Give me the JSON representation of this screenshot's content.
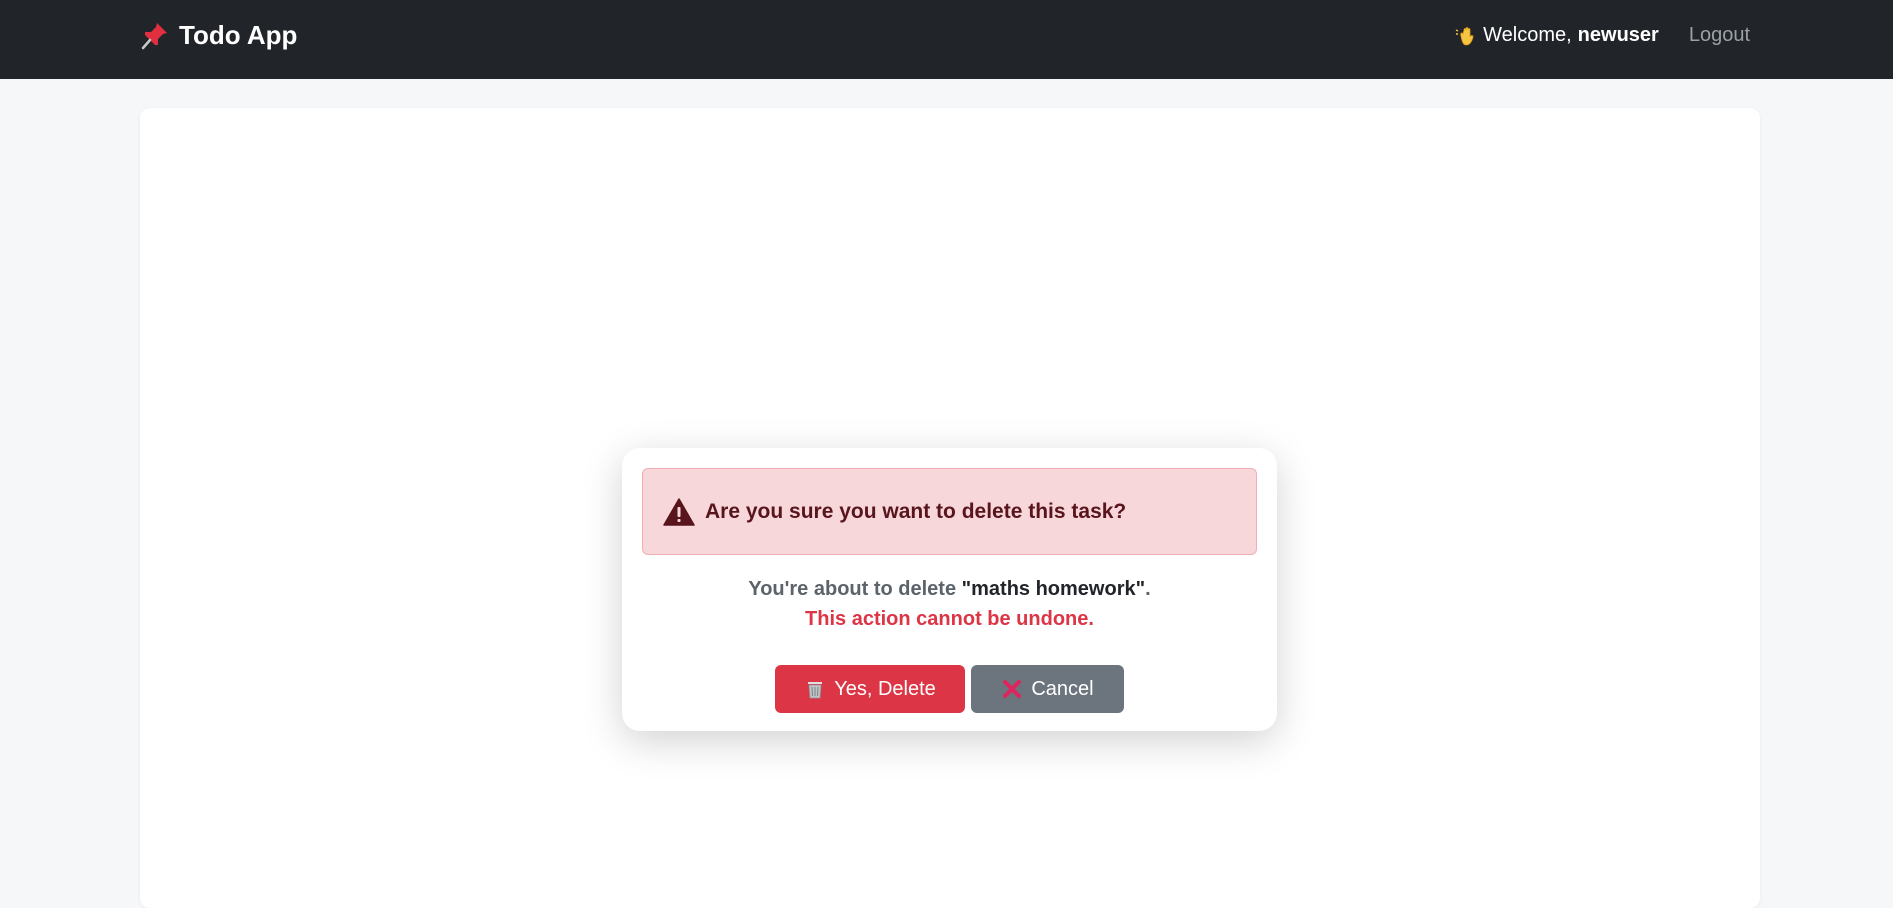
{
  "navbar": {
    "brand": "Todo App",
    "brand_icon": "pushpin-icon",
    "welcome_prefix": "Welcome,",
    "username": "newuser",
    "wave_icon": "waving-hand-icon",
    "logout_label": "Logout"
  },
  "modal": {
    "alert_text": "Are you sure you want to delete this task?",
    "alert_icon": "warning-triangle-icon",
    "message_prefix": "You're about to delete",
    "task_name": "\"maths homework\"",
    "message_suffix": ".",
    "warning": "This action cannot be undone.",
    "delete_label": "Yes, Delete",
    "delete_icon": "wastebasket-icon",
    "cancel_label": "Cancel",
    "cancel_icon": "cross-mark-icon"
  },
  "colors": {
    "navbar_bg": "#212529",
    "danger": "#dc3545",
    "secondary": "#6c757d",
    "alert_bg": "#f8d7da"
  }
}
